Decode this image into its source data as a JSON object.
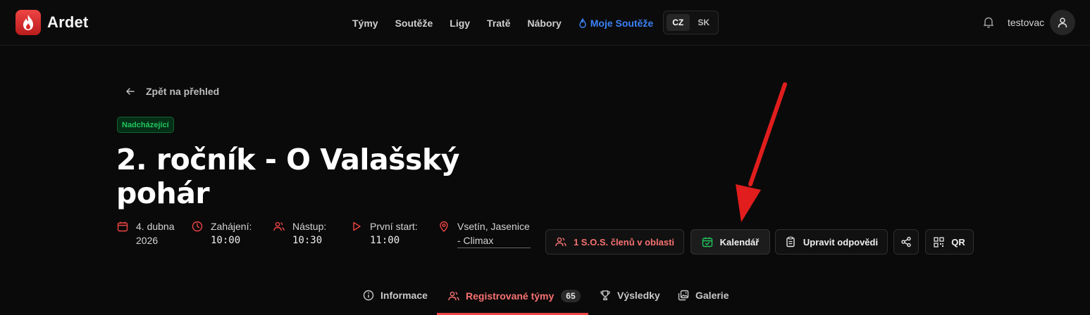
{
  "app": {
    "name": "Ardet",
    "accent_color": "#ef4444"
  },
  "nav": {
    "items": [
      "Týmy",
      "Soutěže",
      "Ligy",
      "Tratě",
      "Nábory"
    ],
    "my_competitions": "Moje Soutěže"
  },
  "language": {
    "options": [
      "CZ",
      "SK"
    ],
    "selected": "CZ"
  },
  "user": {
    "name": "testovac"
  },
  "back_link": "Zpět na přehled",
  "event": {
    "status": "Nadcházející",
    "title": "2. ročník - O Valašský pohár",
    "date": {
      "line1": "4. dubna",
      "line2": "2026"
    },
    "start": {
      "label": "Zahájení:",
      "time": "10:00"
    },
    "lineup": {
      "label": "Nástup:",
      "time": "10:30"
    },
    "first_start": {
      "label": "První start:",
      "time": "11:00"
    },
    "location": {
      "line1": "Vsetín, Jasenice",
      "line2": "- Climax"
    }
  },
  "actions": {
    "sos": "1 S.O.S. členů v oblasti",
    "calendar": "Kalendář",
    "edit_answers": "Upravit odpovědi",
    "share_icon": "share-icon",
    "qr": "QR"
  },
  "tabs": [
    {
      "label": "Informace",
      "icon": "info-icon"
    },
    {
      "label": "Registrované týmy",
      "icon": "users-icon",
      "count": "65",
      "active": true
    },
    {
      "label": "Výsledky",
      "icon": "trophy-icon"
    },
    {
      "label": "Galerie",
      "icon": "gallery-icon"
    }
  ]
}
